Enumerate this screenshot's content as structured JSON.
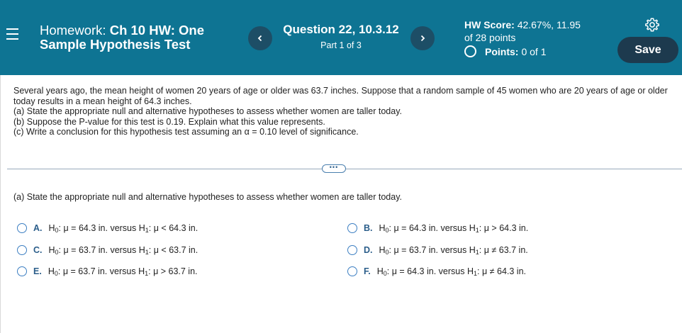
{
  "header": {
    "homework_prefix": "Homework:",
    "homework_name": "Ch 10 HW: One Sample Hypothesis Test",
    "question_title": "Question 22, 10.3.12",
    "question_part": "Part 1 of 3",
    "score_label": "HW Score:",
    "score_value": "42.67%, 11.95",
    "score_suffix": "of 28 points",
    "points_label": "Points:",
    "points_value": "0 of 1",
    "save_label": "Save",
    "colors": {
      "bar": "#0e7493",
      "button_dark": "#1d3a4e"
    }
  },
  "problem": {
    "intro": "Several years ago, the mean height of women 20 years of age or older was 63.7 inches. Suppose that a random sample of 45 women who are 20 years of age or older today results in a mean height of 64.3 inches.",
    "line_a": "(a) State the appropriate null and alternative hypotheses to assess whether women are taller today.",
    "line_b": "(b) Suppose the P-value for this test is 0.19. Explain what this value represents.",
    "line_c": "(c) Write a conclusion for this hypothesis test assuming an α = 0.10 level of significance."
  },
  "expand_label": "•••",
  "part_a": {
    "prompt": "(a) State the appropriate null and alternative hypotheses to assess whether women are taller today.",
    "options": [
      {
        "letter": "A.",
        "h0_mu": "μ = 64.3 in.",
        "h1_mu": "μ < 64.3 in."
      },
      {
        "letter": "B.",
        "h0_mu": "μ = 64.3 in.",
        "h1_mu": "μ > 64.3 in."
      },
      {
        "letter": "C.",
        "h0_mu": "μ = 63.7 in.",
        "h1_mu": "μ < 63.7 in."
      },
      {
        "letter": "D.",
        "h0_mu": "μ = 63.7 in.",
        "h1_mu": "μ ≠ 63.7 in."
      },
      {
        "letter": "E.",
        "h0_mu": "μ = 63.7 in.",
        "h1_mu": "μ > 63.7 in."
      },
      {
        "letter": "F.",
        "h0_mu": "μ = 64.3 in.",
        "h1_mu": "μ ≠ 64.3 in."
      }
    ],
    "h_label": "H",
    "h0_sub": "0",
    "h1_sub": "1",
    "versus": "versus"
  },
  "icons": {
    "menu": "hamburger-icon",
    "prev": "chevron-left-icon",
    "next": "chevron-right-icon",
    "settings": "gear-icon",
    "radio": "radio-unselected"
  }
}
